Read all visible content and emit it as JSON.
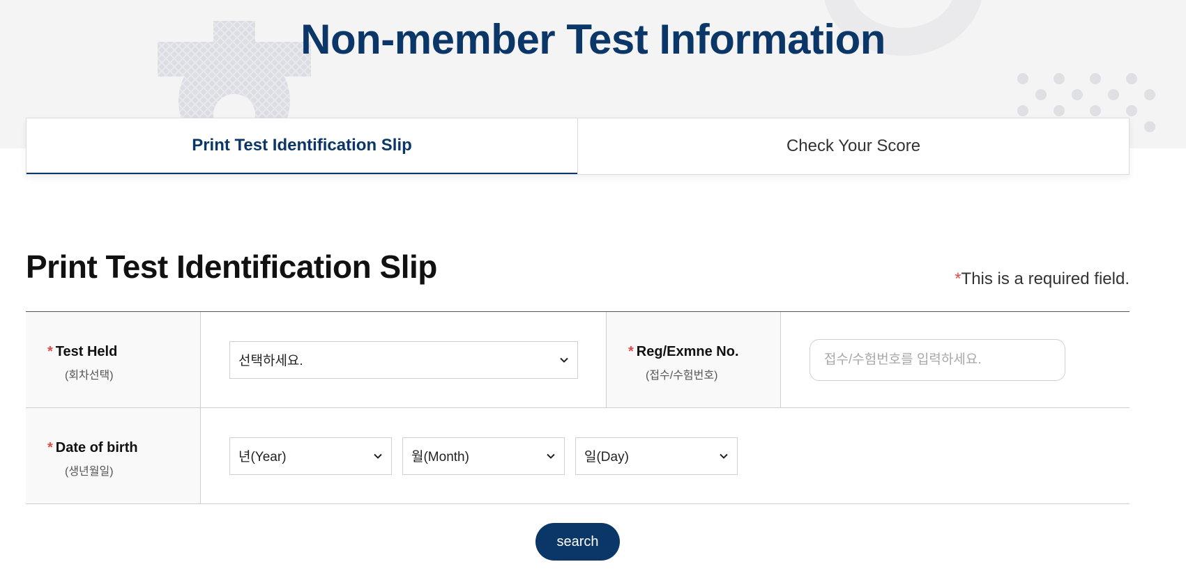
{
  "header": {
    "title": "Non-member Test Information"
  },
  "tabs": [
    {
      "label": "Print Test Identification Slip",
      "active": true
    },
    {
      "label": "Check Your Score",
      "active": false
    }
  ],
  "section": {
    "title": "Print Test Identification Slip",
    "required_star": "*",
    "required_note": "This is a required field."
  },
  "form": {
    "test_held": {
      "label": "Test Held",
      "sub": "(회차선택)",
      "value": "선택하세요."
    },
    "reg_no": {
      "label": "Reg/Exmne No.",
      "sub": "(접수/수험번호)",
      "placeholder": "접수/수험번호를 입력하세요."
    },
    "dob": {
      "label": "Date of birth",
      "sub": "(생년월일)",
      "year": "년(Year)",
      "month": "월(Month)",
      "day": "일(Day)"
    }
  },
  "search_label": "search",
  "colors": {
    "brand": "#0a3668",
    "required": "#e34b4b",
    "highlight": "#b9d6ee"
  }
}
